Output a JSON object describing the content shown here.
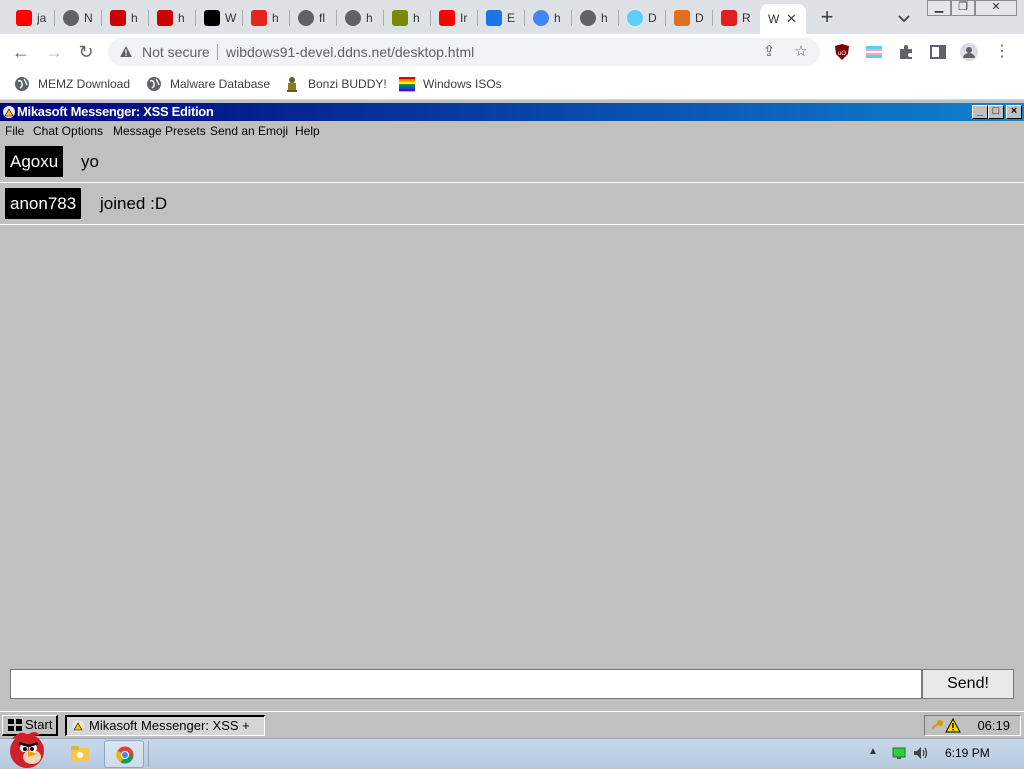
{
  "browser": {
    "tabs": [
      {
        "title": "ja",
        "icon": "youtube-icon",
        "color": "#ff0000"
      },
      {
        "title": "N",
        "icon": "globe-icon",
        "color": "#5f6368"
      },
      {
        "title": "h",
        "icon": "youtube-icon",
        "color": "#cc0000"
      },
      {
        "title": "h",
        "icon": "youtube-icon",
        "color": "#cc0000"
      },
      {
        "title": "W",
        "icon": "archive-icon",
        "color": "#000000"
      },
      {
        "title": "h",
        "icon": "adobe-icon",
        "color": "#e4251d"
      },
      {
        "title": "fl",
        "icon": "globe-icon",
        "color": "#5f6368"
      },
      {
        "title": "h",
        "icon": "globe-icon",
        "color": "#5f6368"
      },
      {
        "title": "h",
        "icon": "chart-icon",
        "color": "#7a8c00"
      },
      {
        "title": "Ir",
        "icon": "youtube-icon",
        "color": "#ff0000"
      },
      {
        "title": "E",
        "icon": "puzzle-icon",
        "color": "#1a73e8"
      },
      {
        "title": "h",
        "icon": "google-icon",
        "color": "#4285f4"
      },
      {
        "title": "h",
        "icon": "globe-icon",
        "color": "#5f6368"
      },
      {
        "title": "D",
        "icon": "flag-icon",
        "color": "#5bcefa"
      },
      {
        "title": "D",
        "icon": "rainbow-icon",
        "color": "#e07020"
      },
      {
        "title": "R",
        "icon": "alert-icon",
        "color": "#e02020"
      },
      {
        "title": "W",
        "icon": "",
        "color": "#ffffff",
        "active": true
      }
    ],
    "new_tab_label": "+",
    "address": {
      "security_label": "Not secure",
      "url": "wibdows91-devel.ddns.net/desktop.html"
    },
    "bookmarks": [
      {
        "label": "MEMZ Download",
        "icon": "globe-icon"
      },
      {
        "label": "Malware Database",
        "icon": "globe-icon"
      },
      {
        "label": "Bonzi BUDDY!",
        "icon": "bonzi-icon"
      },
      {
        "label": "Windows ISOs",
        "icon": "rainbow-icon"
      }
    ]
  },
  "app": {
    "title": "Mikasoft Messenger: XSS Edition",
    "menu": [
      "File",
      "Chat Options",
      "Message Presets",
      "Send an Emoji",
      "Help"
    ],
    "messages": [
      {
        "user": "Agoxu",
        "text": "yo"
      },
      {
        "user": "anon783",
        "text": "joined :D"
      }
    ],
    "input": {
      "value": "",
      "placeholder": ""
    },
    "send_label": "Send!",
    "colors": {
      "titlebar_start": "#00007b",
      "titlebar_end": "#1084d0",
      "window_bg": "#c0c0c0"
    }
  },
  "win95_taskbar": {
    "start_label": "Start",
    "task_label": "Mikasoft Messenger: XSS +",
    "clock": "06:19"
  },
  "win7_taskbar": {
    "clock": "6:19 PM"
  }
}
